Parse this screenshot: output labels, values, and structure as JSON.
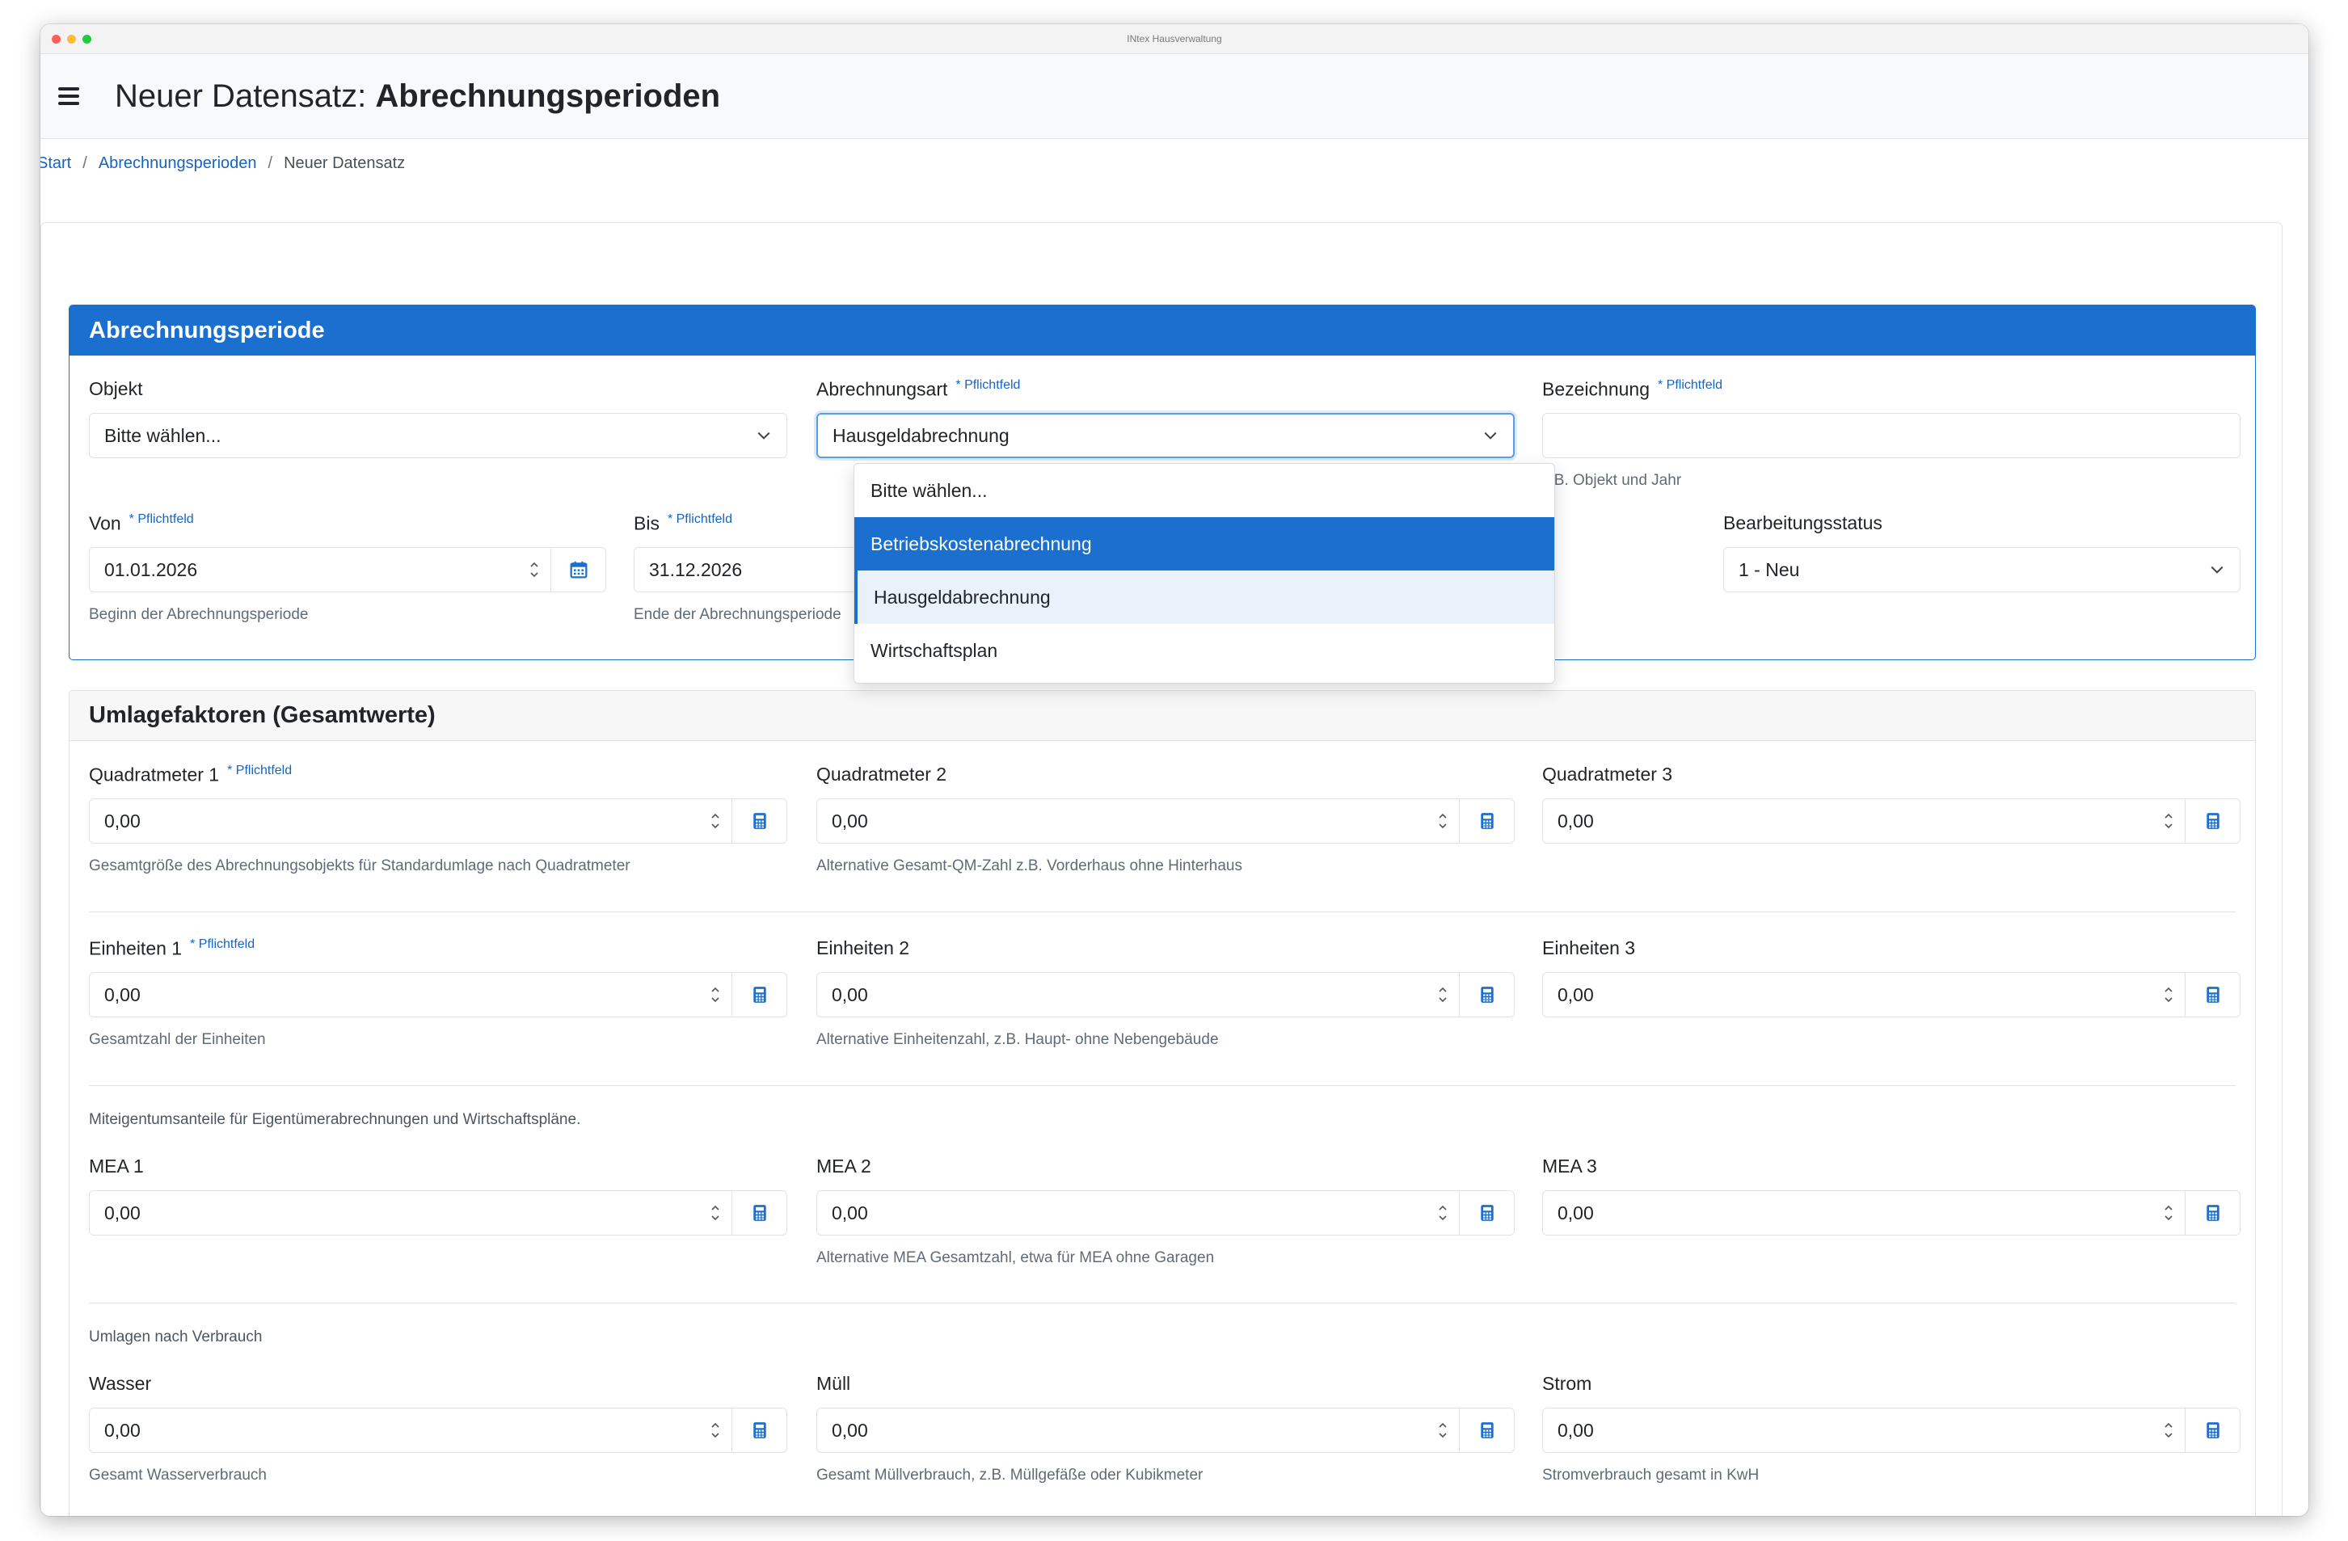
{
  "window": {
    "title": "INtex Hausverwaltung",
    "dots": [
      "#ff5f57",
      "#febc2e",
      "#28c840"
    ]
  },
  "header": {
    "title_prefix": "Neuer Datensatz:",
    "title_entity": "Abrechnungsperioden"
  },
  "breadcrumb": {
    "start": "Start",
    "list": "Abrechnungsperioden",
    "current": "Neuer Datensatz",
    "separator": "/"
  },
  "colors": {
    "accent": "#1b6fce",
    "link": "#1565c0"
  },
  "required_label": "* Pflichtfeld",
  "period": {
    "heading": "Abrechnungsperiode",
    "objekt": {
      "label": "Objekt",
      "value": "Bitte wählen..."
    },
    "abrechnungsart": {
      "label": "Abrechnungsart",
      "value": "Hausgeldabrechnung",
      "options": [
        "Bitte wählen...",
        "Betriebskostenabrechnung",
        "Hausgeldabrechnung",
        "Wirtschaftsplan"
      ]
    },
    "bezeichnung": {
      "label": "Bezeichnung",
      "value": "",
      "help": "z.B. Objekt und Jahr"
    },
    "von": {
      "label": "Von",
      "value": "01.01.2026",
      "help": "Beginn der Abrechnungsperiode"
    },
    "bis": {
      "label": "Bis",
      "value": "31.12.2026",
      "help": "Ende der Abrechnungsperiode"
    },
    "status": {
      "label": "Bearbeitungsstatus",
      "value": "1 - Neu"
    }
  },
  "factors": {
    "heading": "Umlagefaktoren (Gesamtwerte)",
    "qm1": {
      "label": "Quadratmeter 1",
      "value": "0,00",
      "help": "Gesamtgröße des Abrechnungsobjekts für Standardumlage nach Quadratmeter"
    },
    "qm2": {
      "label": "Quadratmeter 2",
      "value": "0,00",
      "help": "Alternative Gesamt-QM-Zahl z.B. Vorderhaus ohne Hinterhaus"
    },
    "qm3": {
      "label": "Quadratmeter 3",
      "value": "0,00"
    },
    "eh1": {
      "label": "Einheiten 1",
      "value": "0,00",
      "help": "Gesamtzahl der Einheiten"
    },
    "eh2": {
      "label": "Einheiten 2",
      "value": "0,00",
      "help": "Alternative Einheitenzahl, z.B. Haupt- ohne Nebengebäude"
    },
    "eh3": {
      "label": "Einheiten 3",
      "value": "0,00"
    },
    "mea_note": "Miteigentumsanteile für Eigentümerabrechnungen und Wirtschaftspläne.",
    "mea1": {
      "label": "MEA 1",
      "value": "0,00"
    },
    "mea2": {
      "label": "MEA 2",
      "value": "0,00",
      "help": "Alternative MEA Gesamtzahl, etwa für MEA ohne Garagen"
    },
    "mea3": {
      "label": "MEA 3",
      "value": "0,00"
    },
    "verbrauch_note": "Umlagen nach Verbrauch",
    "wasser": {
      "label": "Wasser",
      "value": "0,00",
      "help": "Gesamt Wasserverbrauch"
    },
    "muell": {
      "label": "Müll",
      "value": "0,00",
      "help": "Gesamt Müllverbrauch, z.B. Müllgefäße oder Kubikmeter"
    },
    "strom": {
      "label": "Strom",
      "value": "0,00",
      "help": "Stromverbrauch gesamt in KwH"
    }
  }
}
